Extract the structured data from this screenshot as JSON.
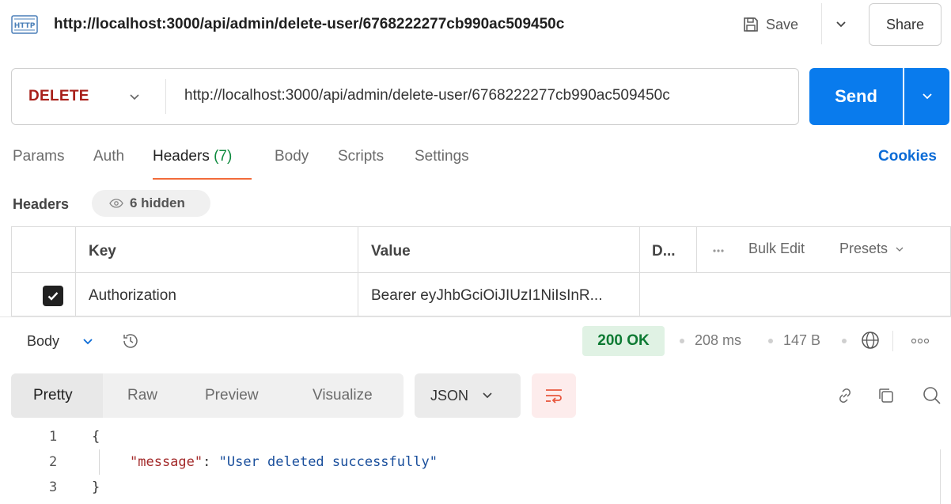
{
  "title_bar": {
    "icon_text": "HTTP",
    "url": "http://localhost:3000/api/admin/delete-user/6768222277cb990ac509450c",
    "save_label": "Save",
    "share_label": "Share"
  },
  "request": {
    "method": "DELETE",
    "url": "http://localhost:3000/api/admin/delete-user/6768222277cb990ac509450c",
    "send_label": "Send"
  },
  "tabs": {
    "params": "Params",
    "auth": "Auth",
    "headers": "Headers",
    "headers_count": "(7)",
    "body": "Body",
    "scripts": "Scripts",
    "settings": "Settings",
    "cookies": "Cookies"
  },
  "headers_section": {
    "label": "Headers",
    "hidden": "6 hidden",
    "columns": {
      "key": "Key",
      "value": "Value",
      "description": "D...",
      "bulk_edit": "Bulk Edit",
      "presets": "Presets"
    },
    "rows": [
      {
        "checked": true,
        "key": "Authorization",
        "value": "Bearer eyJhbGciOiJIUzI1NiIsInR..."
      }
    ]
  },
  "response": {
    "body_label": "Body",
    "status": "200 OK",
    "time": "208 ms",
    "size": "147 B",
    "views": {
      "pretty": "Pretty",
      "raw": "Raw",
      "preview": "Preview",
      "visualize": "Visualize"
    },
    "format": "JSON",
    "code_lines": [
      {
        "num": "1",
        "open": "{"
      },
      {
        "num": "2",
        "key": "\"message\"",
        "sep": ": ",
        "value": "\"User deleted successfully\""
      },
      {
        "num": "3",
        "close": "}"
      }
    ]
  },
  "colors": {
    "method": "#a8201a",
    "send": "#097bed",
    "status_ok": "#0d7a33",
    "tab_accent": "#f26b3a",
    "link": "#0b6bd6"
  }
}
